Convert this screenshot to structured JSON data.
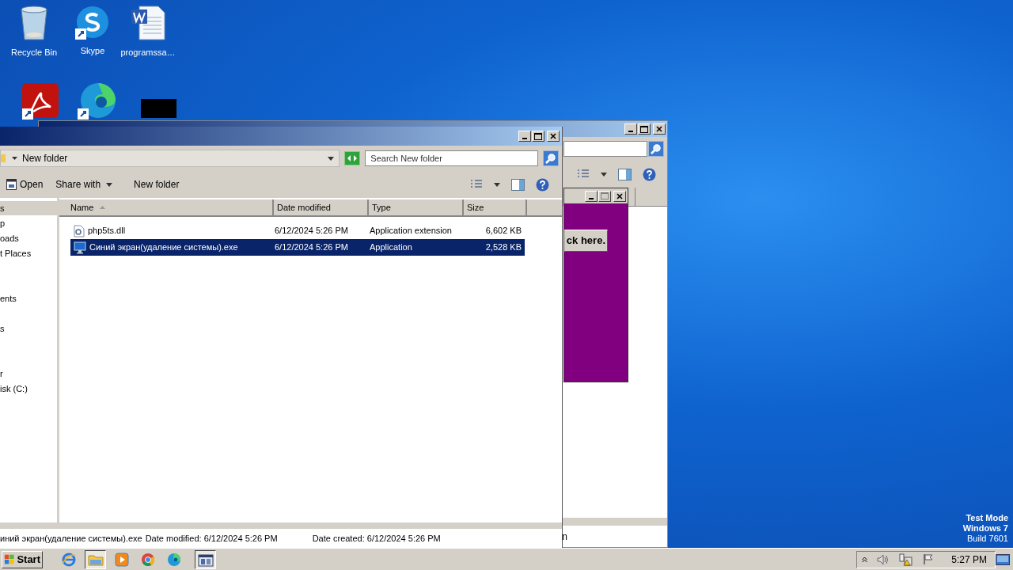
{
  "desktop_icons": [
    {
      "kind": "recycle",
      "label": "Recycle Bin"
    },
    {
      "kind": "skype",
      "label": "Skype"
    },
    {
      "kind": "word",
      "label": "programssa…"
    },
    {
      "kind": "acrobat"
    },
    {
      "kind": "edge"
    },
    {
      "kind": "black"
    }
  ],
  "back_window": {
    "status_text": "n"
  },
  "dialog": {
    "button": "ck here."
  },
  "explorer": {
    "breadcrumb": "New folder",
    "search_placeholder": "Search New folder",
    "toolbar": [
      {
        "kind": "open",
        "label": "Open"
      },
      {
        "kind": "menu",
        "label": "Share with"
      },
      {
        "kind": "plain",
        "label": "New folder"
      }
    ],
    "nav_items": [
      {
        "label": "s",
        "selected": true
      },
      {
        "label": "p",
        "selected": false
      },
      {
        "label": "oads",
        "selected": false
      },
      {
        "label": "t Places",
        "selected": false
      },
      {
        "label": "ents",
        "selected": false
      },
      {
        "label": "s",
        "selected": false
      },
      {
        "label": "r",
        "selected": false
      },
      {
        "label": "isk (C:)",
        "selected": false
      }
    ],
    "columns": [
      {
        "label": "Name",
        "sorted": true
      },
      {
        "label": "Date modified",
        "sorted": false
      },
      {
        "label": "Type",
        "sorted": false
      },
      {
        "label": "Size",
        "sorted": false
      }
    ],
    "rows": [
      {
        "kind": "dll",
        "name": "php5ts.dll",
        "date": "6/12/2024 5:26 PM",
        "type": "Application extension",
        "size": "6,602 KB",
        "selected": false
      },
      {
        "kind": "exe",
        "name": "Синий экран(удаление системы).exe",
        "date": "6/12/2024 5:26 PM",
        "type": "Application",
        "size": "2,528 KB",
        "selected": true
      }
    ],
    "status": {
      "name": "иний экран(удаление системы).exe",
      "modified": "Date modified: 6/12/2024 5:26 PM",
      "created": "Date created: 6/12/2024 5:26 PM"
    }
  },
  "os_notice": [
    "Test Mode",
    "Windows 7",
    "Build 7601"
  ],
  "taskbar": {
    "start": "Start",
    "apps": [
      {
        "kind": "ie",
        "active": false
      },
      {
        "kind": "explorer",
        "active": true
      },
      {
        "kind": "media",
        "active": false
      },
      {
        "kind": "chrome",
        "active": false
      },
      {
        "kind": "edge",
        "active": false
      },
      {
        "kind": "app",
        "active": true
      }
    ],
    "clock": "5:27 PM"
  }
}
